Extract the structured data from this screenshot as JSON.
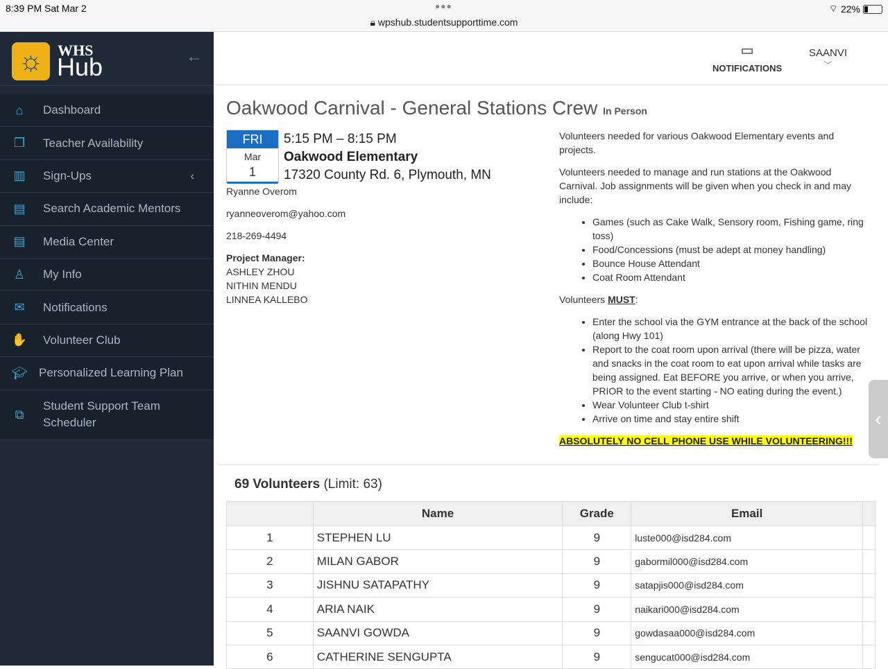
{
  "status": {
    "time": "8:39 PM  Sat Mar 2",
    "url": "wpshub.studentsupporttime.com",
    "battery": "22%"
  },
  "sidebar": {
    "logo_top": "WHS",
    "logo_bottom": "Hub",
    "items": [
      {
        "label": "Dashboard",
        "icon": "home"
      },
      {
        "label": "Teacher Availability",
        "icon": "copy"
      },
      {
        "label": "Sign-Ups",
        "icon": "map"
      },
      {
        "label": "Search Academic Mentors",
        "icon": "calendar"
      },
      {
        "label": "Media Center",
        "icon": "calendar"
      },
      {
        "label": "My Info",
        "icon": "user"
      },
      {
        "label": "Notifications",
        "icon": "envelope"
      },
      {
        "label": "Volunteer Club",
        "icon": "hand"
      },
      {
        "label": "Personalized Learning Plan",
        "icon": "graduation-cap"
      },
      {
        "label": "Student Support Team Scheduler",
        "icon": "external-link"
      }
    ]
  },
  "header": {
    "notifications": "NOTIFICATIONS",
    "user": "SAANVI"
  },
  "event": {
    "title": "Oakwood Carnival - General Stations Crew",
    "mode": "In Person",
    "day": "FRI",
    "month": "Mar",
    "date": "1",
    "time": "5:15 PM – 8:15 PM",
    "location": "Oakwood Elementary",
    "address": "17320 County Rd. 6, Plymouth, MN",
    "contact": "Ryanne Overom",
    "email": "ryanneoverom@yahoo.com",
    "phone": "218-269-4494",
    "pm_label": "Project Manager:",
    "managers": [
      "ASHLEY ZHOU",
      "NITHIN MENDU",
      "LINNEA KALLEBO"
    ],
    "desc1": "Volunteers needed for various Oakwood Elementary events and projects.",
    "desc2": "Volunteers needed to manage and run stations at the Oakwood Carnival. Job assignments will be given when you check in and may include:",
    "jobs": [
      "Games (such as Cake Walk, Sensory room, Fishing game, ring toss)",
      "Food/Concessions (must be adept at money handling)",
      "Bounce House Attendant",
      "Coat Room Attendant"
    ],
    "must_prefix": "Volunteers ",
    "must": "MUST",
    "must_suffix": ":",
    "rules": [
      "Enter the school via the GYM entrance at the back of the school (along Hwy 101)",
      "Report to the coat room upon arrival (there will be pizza, water and snacks in the coat room to eat upon arrival while tasks are being assigned. Eat BEFORE you arrive, or when you arrive, PRIOR to the event starting - NO eating during the event.)",
      "Wear Volunteer Club t-shirt",
      "Arrive on time and stay entire shift"
    ],
    "warning": "ABSOLUTELY NO CELL PHONE USE WHILE VOLUNTEERING!!!"
  },
  "volunteers": {
    "count": "69 Volunteers",
    "limit": "(Limit: 63)",
    "columns": [
      "",
      "Name",
      "Grade",
      "Email"
    ],
    "rows": [
      [
        "1",
        "STEPHEN LU",
        "9",
        "luste000@isd284.com"
      ],
      [
        "2",
        "MILAN GABOR",
        "9",
        "gabormil000@isd284.com"
      ],
      [
        "3",
        "JISHNU SATAPATHY",
        "9",
        "satapjis000@isd284.com"
      ],
      [
        "4",
        "ARIA NAIK",
        "9",
        "naikari000@isd284.com"
      ],
      [
        "5",
        "SAANVI GOWDA",
        "9",
        "gowdasaa000@isd284.com"
      ],
      [
        "6",
        "CATHERINE SENGUPTA",
        "9",
        "sengucat000@isd284.com"
      ]
    ]
  }
}
